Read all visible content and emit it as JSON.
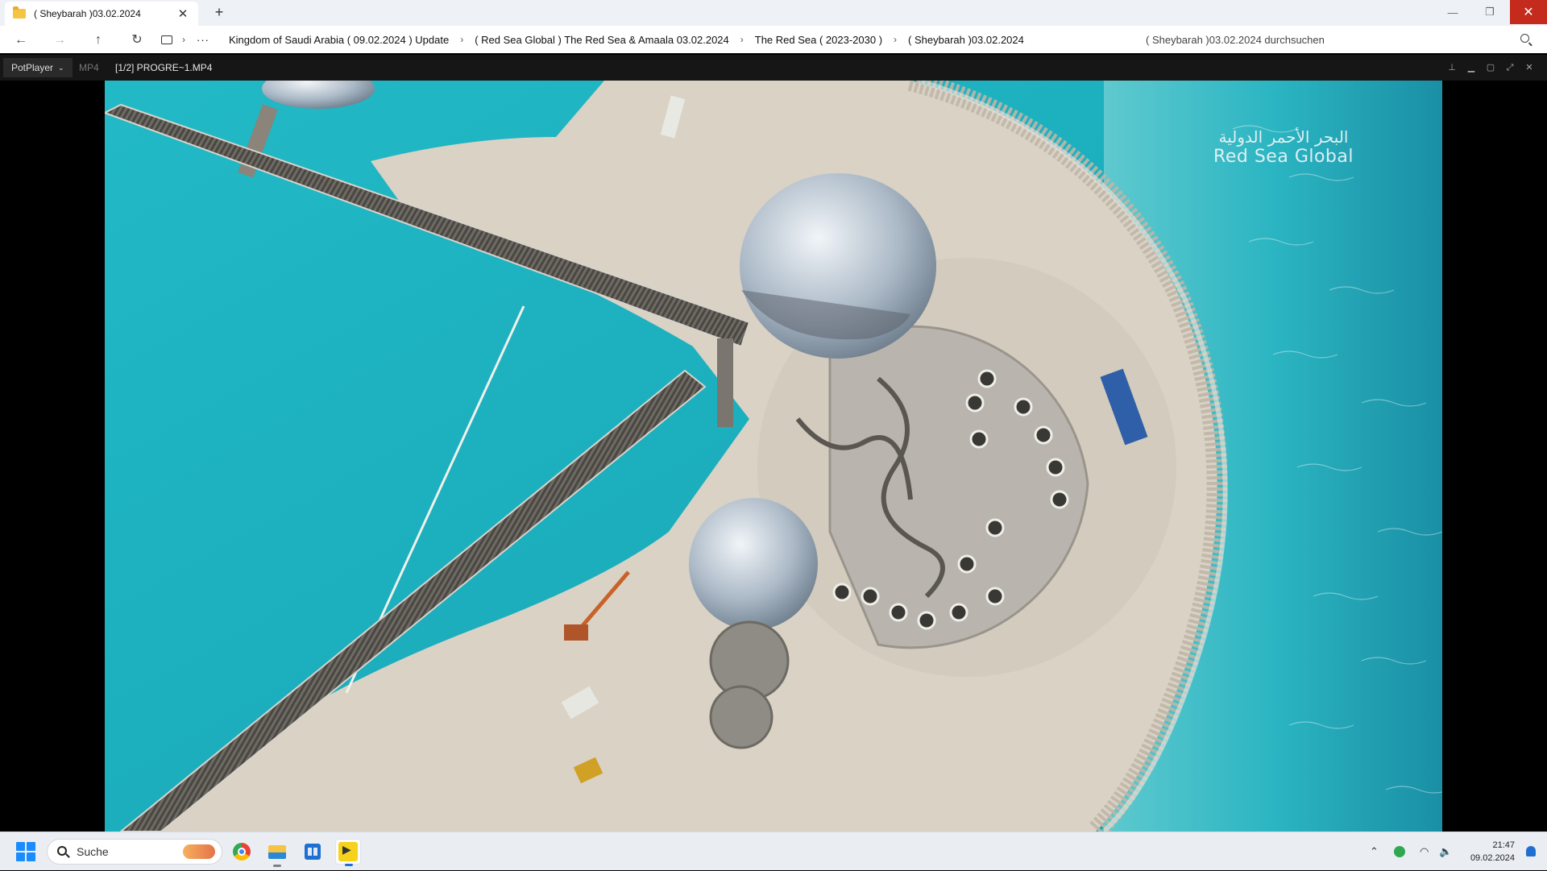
{
  "explorer": {
    "tab_title": "( Sheybarah )03.02.2024",
    "tab_close": "✕",
    "new_tab": "+",
    "window_controls": {
      "minimize": "—",
      "restore": "❐",
      "close": "✕"
    },
    "nav": {
      "back": "←",
      "forward": "→",
      "up": "↑",
      "refresh": "↻"
    },
    "breadcrumb_overflow": "···",
    "breadcrumbs": [
      "Kingdom of Saudi Arabia ( 09.02.2024 ) Update",
      "( Red Sea Global ) The Red Sea & Amaala 03.02.2024",
      "The Red Sea ( 2023-2030 )",
      "( Sheybarah )03.02.2024"
    ],
    "search_placeholder": "( Sheybarah )03.02.2024 durchsuchen"
  },
  "player": {
    "brand": "PotPlayer",
    "format": "MP4",
    "file": "[1/2] PROGRE~1.MP4",
    "controls": [
      "pin-icon",
      "minimize-icon",
      "maximize-icon",
      "fullscreen-icon",
      "close-icon"
    ]
  },
  "video": {
    "watermark_arabic": "البحر الأحمر الدولية",
    "watermark_english": "Red Sea Global"
  },
  "taskbar": {
    "search_label": "Suche",
    "apps": [
      "chrome-icon",
      "file-explorer-icon",
      "store-icon",
      "potplayer-icon"
    ],
    "time": "21:47",
    "date": "09.02.2024"
  },
  "colors": {
    "close_red": "#c42b1c",
    "water_turquoise": "#1fb3c0",
    "sand": "#d9d2c5",
    "start_blue": "#1a8cff"
  }
}
